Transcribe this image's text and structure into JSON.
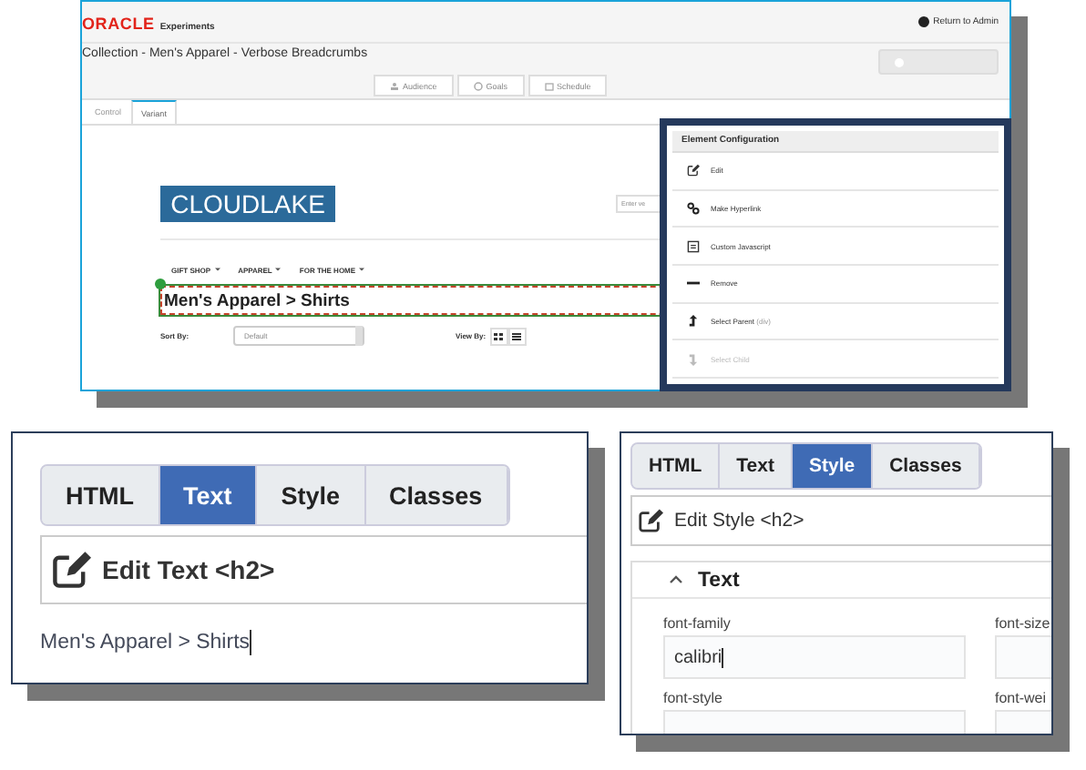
{
  "experiment_window": {
    "brand": "ORACLE",
    "brand_suffix": "Experiments",
    "return_link": "Return to Admin",
    "title": "Collection - Men's Apparel - Verbose Breadcrumbs",
    "start_button": {
      "disabled": true
    },
    "toolbar": [
      {
        "kind": "audience",
        "label": "Audience"
      },
      {
        "kind": "goals",
        "label": "Goals"
      },
      {
        "kind": "schedule",
        "label": "Schedule"
      }
    ],
    "tabs": [
      {
        "label": "Control",
        "selected": false
      },
      {
        "label": "Variant",
        "selected": true
      }
    ],
    "preview": {
      "logo": "CLOUDLAKE",
      "search_placeholder": "Enter ve",
      "nav": [
        "GIFT SHOP",
        "APPAREL",
        "FOR THE HOME"
      ],
      "heading": "Men's Apparel > Shirts",
      "sort_label": "Sort By:",
      "sort_value": "Default",
      "view_label": "View By:"
    }
  },
  "element_configuration": {
    "title": "Element Configuration",
    "items": [
      {
        "kind": "edit",
        "label": "Edit",
        "disabled": false
      },
      {
        "kind": "link",
        "label": "Make Hyperlink",
        "disabled": false
      },
      {
        "kind": "script",
        "label": "Custom Javascript",
        "disabled": false
      },
      {
        "kind": "remove",
        "label": "Remove",
        "disabled": false
      },
      {
        "kind": "parent",
        "label": "Select Parent",
        "hint": "(div)",
        "disabled": false
      },
      {
        "kind": "child",
        "label": "Select Child",
        "disabled": true
      }
    ]
  },
  "text_editor": {
    "tabs": [
      {
        "label": "HTML",
        "selected": false
      },
      {
        "label": "Text",
        "selected": true
      },
      {
        "label": "Style",
        "selected": false
      },
      {
        "label": "Classes",
        "selected": false
      }
    ],
    "header": "Edit Text <h2>",
    "value": "Men's Apparel > Shirts"
  },
  "style_editor": {
    "tabs": [
      {
        "label": "HTML",
        "selected": false
      },
      {
        "label": "Text",
        "selected": false
      },
      {
        "label": "Style",
        "selected": true
      },
      {
        "label": "Classes",
        "selected": false
      }
    ],
    "header": "Edit Style <h2>",
    "section": "Text",
    "expanded": true,
    "fields": [
      {
        "label": "font-family",
        "value": "calibri"
      },
      {
        "label": "font-size"
      },
      {
        "label": "font-style"
      },
      {
        "label": "font-wei"
      }
    ]
  }
}
